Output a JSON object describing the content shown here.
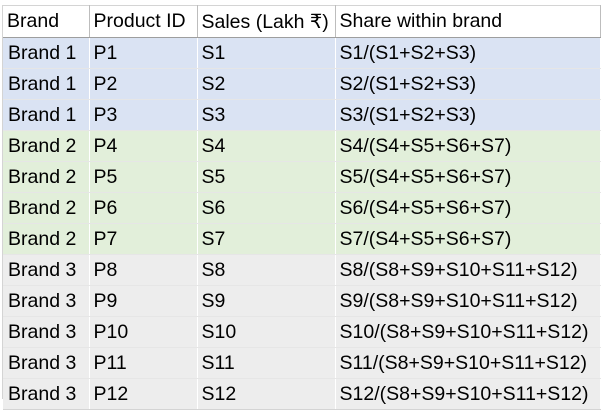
{
  "table": {
    "headers": {
      "brand": "Brand",
      "product_id": "Product ID",
      "sales": "Sales (Lakh ₹)",
      "share": "Share within brand"
    },
    "rows": [
      {
        "brand": "Brand 1",
        "product_id": "P1",
        "sales": "S1",
        "share": "S1/(S1+S2+S3)",
        "group": 1
      },
      {
        "brand": "Brand 1",
        "product_id": "P2",
        "sales": "S2",
        "share": "S2/(S1+S2+S3)",
        "group": 1
      },
      {
        "brand": "Brand 1",
        "product_id": "P3",
        "sales": "S3",
        "share": "S3/(S1+S2+S3)",
        "group": 1
      },
      {
        "brand": "Brand 2",
        "product_id": "P4",
        "sales": "S4",
        "share": "S4/(S4+S5+S6+S7)",
        "group": 2
      },
      {
        "brand": "Brand 2",
        "product_id": "P5",
        "sales": "S5",
        "share": "S5/(S4+S5+S6+S7)",
        "group": 2
      },
      {
        "brand": "Brand 2",
        "product_id": "P6",
        "sales": "S6",
        "share": "S6/(S4+S5+S6+S7)",
        "group": 2
      },
      {
        "brand": "Brand 2",
        "product_id": "P7",
        "sales": "S7",
        "share": "S7/(S4+S5+S6+S7)",
        "group": 2
      },
      {
        "brand": "Brand 3",
        "product_id": "P8",
        "sales": "S8",
        "share": "S8/(S8+S9+S10+S11+S12)",
        "group": 3
      },
      {
        "brand": "Brand 3",
        "product_id": "P9",
        "sales": "S9",
        "share": "S9/(S8+S9+S10+S11+S12)",
        "group": 3
      },
      {
        "brand": "Brand 3",
        "product_id": "P10",
        "sales": "S10",
        "share": "S10/(S8+S9+S10+S11+S12)",
        "group": 3
      },
      {
        "brand": "Brand 3",
        "product_id": "P11",
        "sales": "S11",
        "share": "S11/(S8+S9+S10+S11+S12)",
        "group": 3
      },
      {
        "brand": "Brand 3",
        "product_id": "P12",
        "sales": "S12",
        "share": "S12/(S8+S9+S10+S11+S12)",
        "group": 3
      }
    ]
  },
  "colors": {
    "brand_1_fill": "#dae3f3",
    "brand_2_fill": "#e2efda",
    "brand_3_fill": "#ededed",
    "gridline": "#d4d4d4"
  }
}
